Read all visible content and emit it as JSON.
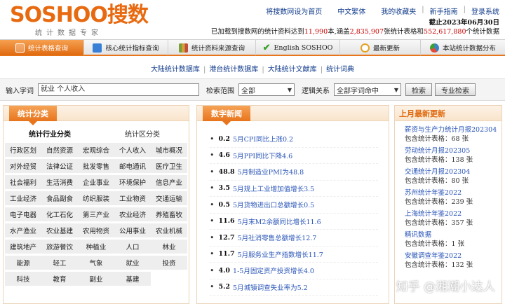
{
  "logo": {
    "main": "SOSHOO搜数",
    "sub": "统计数据专家"
  },
  "top_links": [
    "将搜数网设为首页",
    "中文繁体",
    "我的收藏夹",
    "新手指南",
    "登录系统"
  ],
  "info": {
    "date": "截止2023年06月30日",
    "prefix": "已加载到搜数网的统计资料达到",
    "docs": "11,990",
    "mid1": "本,涵盖",
    "tables": "2,835,907",
    "mid2": "张统计表格和",
    "indicators": "552,617,880",
    "suffix": "个统计数据"
  },
  "tabs": [
    {
      "label": "统计表格查询",
      "color": "#ffffff"
    },
    {
      "label": "核心统计指标查询",
      "color": "#3a7fd6"
    },
    {
      "label": "统计资料来源查询",
      "color": "#7b9e3a"
    },
    {
      "label": "English SOSHOO",
      "color": "#3ea031"
    },
    {
      "label": "最新更新",
      "color": "#e3a322"
    },
    {
      "label": "本站统计数据分布",
      "color": "#3b82c8"
    }
  ],
  "subnav": [
    "大陆统计数据库",
    "港台统计数据库",
    "大陆统计文献库",
    "统计词典"
  ],
  "search": {
    "label": "输入字词",
    "value": "就业 个人收入",
    "scope_label": "检索范围",
    "scope_value": "全部",
    "logic_label": "逻辑关系",
    "logic_value": "全部字词命中",
    "search_btn": "检索",
    "pro_btn": "专业检索"
  },
  "category": {
    "title": "统计分类",
    "head_industry": "统计行业分类",
    "head_region": "统计区分类",
    "cells": [
      "行政区划",
      "自然资源",
      "宏观综合",
      "个人收入",
      "城市概况",
      "对外经贸",
      "法律公证",
      "批发零售",
      "邮电通讯",
      "医疗卫生",
      "社会福利",
      "生活消费",
      "企业事业",
      "环境保护",
      "信息产业",
      "工业经济",
      "食品副食",
      "纺织服装",
      "工业物资",
      "交通运输",
      "电子电器",
      "化工石化",
      "第三产业",
      "农业经济",
      "养殖畜牧",
      "水产渔业",
      "农业基建",
      "农用物资",
      "公用事业",
      "农业机械",
      "建筑地产",
      "旅游餐饮",
      "种植业",
      "人口",
      "林业",
      "能源",
      "轻工",
      "气象",
      "就业",
      "投资",
      "科技",
      "教育",
      "副业",
      "基建",
      ""
    ]
  },
  "news": {
    "title": "数字新闻",
    "items": [
      {
        "num": "0.2",
        "text": "5月CPI同比上涨0.2"
      },
      {
        "num": "4.6",
        "text": "5月PPI同比下降4.6"
      },
      {
        "num": "48.8",
        "text": "5月制造业PMI为48.8"
      },
      {
        "num": "3.5",
        "text": "5月规上工业增加值增长3.5"
      },
      {
        "num": "0.5",
        "text": "5月货物进出口总额增长0.5"
      },
      {
        "num": "11.6",
        "text": "5月末M2余额同比增长11.6"
      },
      {
        "num": "12.7",
        "text": "5月社消零售总额增长12.7"
      },
      {
        "num": "11.7",
        "text": "5月服务业生产指数增长11.7"
      },
      {
        "num": "4.0",
        "text": "1-5月固定资产投资增长4.0"
      },
      {
        "num": "5.2",
        "text": "5月城镇调查失业率为5.2"
      }
    ]
  },
  "june": {
    "title": "上月最新更新",
    "items": [
      {
        "title": "薪资与生产力统计月报202304",
        "count": "包含统计表格：68 张"
      },
      {
        "title": "劳动统计月报202305",
        "count": "包含统计表格：138 张"
      },
      {
        "title": "交通统计月报202304",
        "count": "包含统计表格：80 张"
      },
      {
        "title": "苏州统计年鉴2022",
        "count": "包含统计表格：239 张"
      },
      {
        "title": "上海统计年鉴2022",
        "count": "包含统计表格：357 张"
      },
      {
        "title": "精讯数据",
        "count": "包含统计表格：1 张"
      },
      {
        "title": "安徽调查年鉴2022",
        "count": "包含统计表格：132 张"
      }
    ]
  },
  "watermark": "知乎 @湘潮小达人"
}
